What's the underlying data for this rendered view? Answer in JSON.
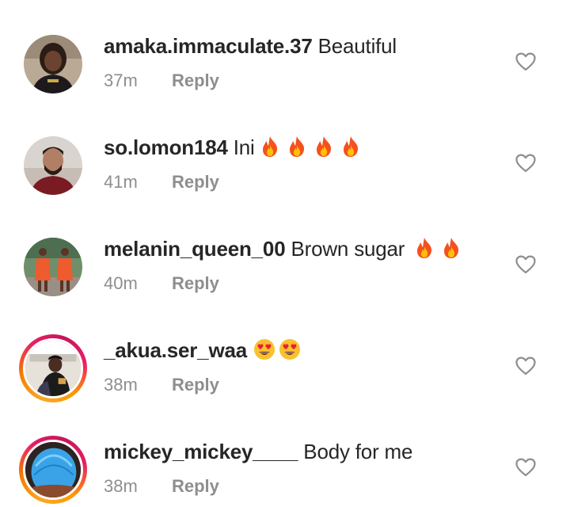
{
  "comments": [
    {
      "username": "amaka.immaculate.37",
      "text": "Beautiful",
      "emojis": [],
      "time": "37m",
      "reply_label": "Reply",
      "story_ring": false
    },
    {
      "username": "so.lomon184",
      "text": "Ini",
      "emojis": [
        "fire",
        "fire",
        "fire",
        "fire"
      ],
      "time": "41m",
      "reply_label": "Reply",
      "story_ring": false
    },
    {
      "username": "melanin_queen_00",
      "text": "Brown sugar",
      "emojis": [
        "fire",
        "fire"
      ],
      "time": "40m",
      "reply_label": "Reply",
      "story_ring": false
    },
    {
      "username": "_akua.ser_waa",
      "text": "",
      "emojis": [
        "heart-eyes",
        "heart-eyes"
      ],
      "time": "38m",
      "reply_label": "Reply",
      "story_ring": true
    },
    {
      "username": "mickey_mickey____",
      "text": "Body for me",
      "emojis": [],
      "time": "38m",
      "reply_label": "Reply",
      "story_ring": true
    }
  ],
  "colors": {
    "text": "#262626",
    "meta": "#8e8e8e",
    "heart_outline": "#8e8e8e"
  }
}
